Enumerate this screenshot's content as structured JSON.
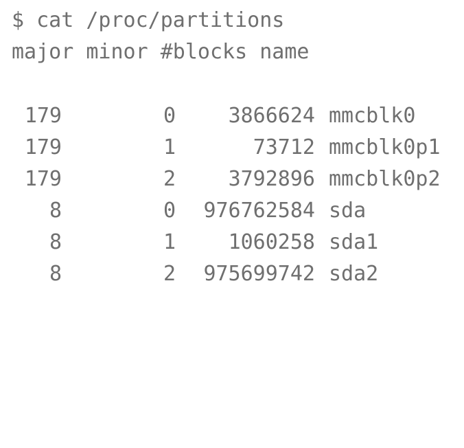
{
  "terminal": {
    "command": "$ cat /proc/partitions",
    "header": "major minor #blocks name",
    "rows": [
      {
        "major": "179",
        "minor": "0",
        "blocks": "3866624",
        "name": "mmcblk0"
      },
      {
        "major": "179",
        "minor": "1",
        "blocks": "73712",
        "name": "mmcblk0p1"
      },
      {
        "major": "179",
        "minor": "2",
        "blocks": "3792896",
        "name": "mmcblk0p2"
      },
      {
        "major": "8",
        "minor": "0",
        "blocks": "976762584",
        "name": "sda"
      },
      {
        "major": "8",
        "minor": "1",
        "blocks": "1060258",
        "name": "sda1"
      },
      {
        "major": "8",
        "minor": "2",
        "blocks": "975699742",
        "name": "sda2"
      }
    ],
    "colors": {
      "background": "#ffffff",
      "text": "#6f6f6f"
    }
  }
}
